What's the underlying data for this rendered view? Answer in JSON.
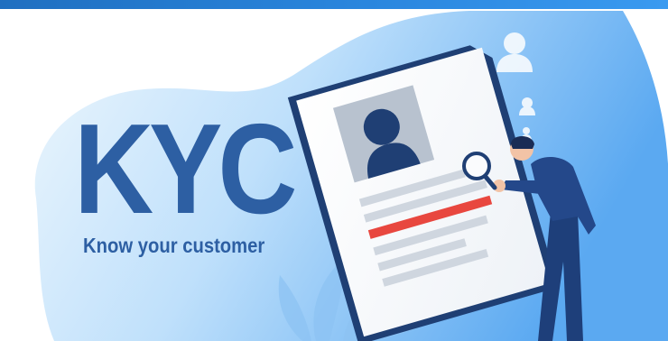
{
  "banner": {
    "title": "KYC",
    "subtitle": "Know your customer"
  },
  "colors": {
    "topbar": "#1f6fc0",
    "title_text": "#2d5fa3",
    "blob_light": "#d8ecfb",
    "blob_dark": "#5aaaf2",
    "highlight_bar": "#e8473f",
    "suit": "#1e3f7a"
  },
  "icons": [
    "user-profile-icon",
    "magnifying-glass-icon",
    "people-icons",
    "leaf-plant-icon"
  ]
}
